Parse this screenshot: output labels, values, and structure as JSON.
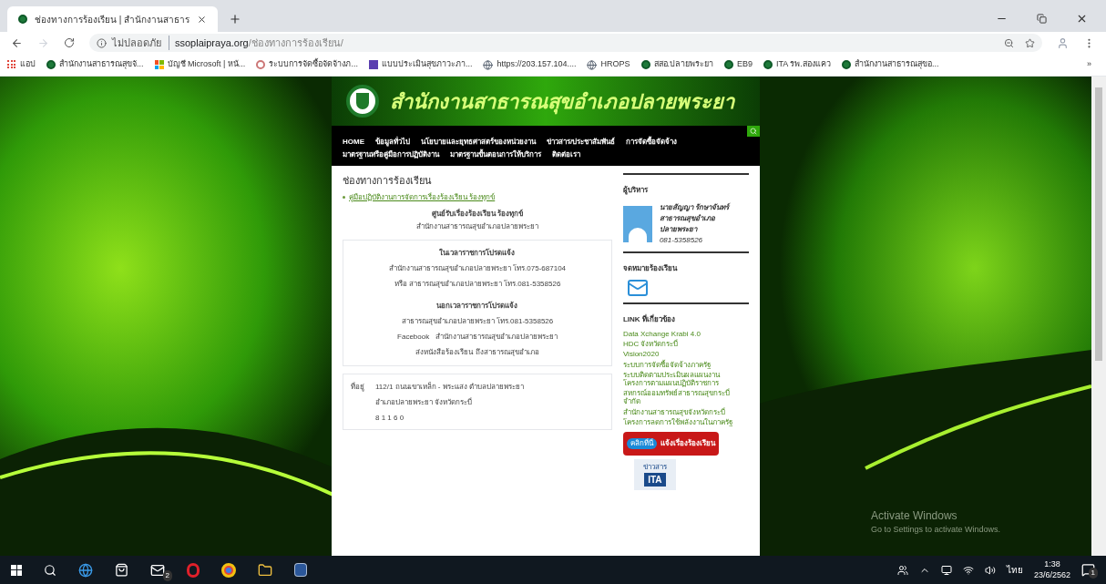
{
  "browser": {
    "tabs": [
      {
        "title": "ช่องทางการร้องเรียน | สำนักงานสาธาร",
        "selected": true
      }
    ],
    "address": {
      "security": "ไม่ปลอดภัย",
      "domain": "ssoplaipraya.org",
      "path": "/ช่องทางการร้องเรียน/"
    },
    "bookmarks": [
      {
        "kind": "apps",
        "label": "แอป"
      },
      {
        "kind": "site",
        "label": "สำนักงานสาธารณสุขจั..."
      },
      {
        "kind": "ms",
        "label": "บัญชี Microsoft | หน้..."
      },
      {
        "kind": "egp",
        "label": "ระบบการจัดซื้อจัดจ้างภ..."
      },
      {
        "kind": "form",
        "label": "แบบประเมินสุขภาวะภา..."
      },
      {
        "kind": "globe",
        "label": "https://203.157.104...."
      },
      {
        "kind": "globe",
        "label": "HROPS"
      },
      {
        "kind": "site",
        "label": "สสอ.ปลายพระยา"
      },
      {
        "kind": "site",
        "label": "EB9"
      },
      {
        "kind": "site",
        "label": "ITA รพ.สองแคว"
      },
      {
        "kind": "site",
        "label": "สำนักงานสาธารณสุขอ..."
      }
    ],
    "overflow": "»"
  },
  "site": {
    "banner_title": "สำนักงานสาธารณสุขอำเภอปลายพระยา",
    "nav": [
      "HOME",
      "ข้อมูลทั่วไป",
      "นโยบายและยุทธศาสตร์ของหน่วยงาน",
      "ข่าวสาร/ประชาสัมพันธ์",
      "การจัดซื้อจัดจ้าง",
      "มาตรฐานหรือคู่มือการปฏิบัติงาน",
      "มาตรฐานขั้นตอนการให้บริการ",
      "ติดต่อเรา"
    ],
    "page_title": "ช่องทางการร้องเรียน",
    "manual_link": "คู่มือปฏิบัติงานการจัดการเรื่องร้องเรียน ร้องทุกข์",
    "center_lines": [
      "ศูนย์รับเรื่องร้องเรียน ร้องทุกข์",
      "สำนักงานสาธารณสุขอำเภอปลายพระยา"
    ],
    "contact_box": [
      {
        "heading": "ในเวลาราชการโปรดแจ้ง",
        "lines": [
          "สำนักงานสาธารณสุขอำเภอปลายพระยา โทร.075-687104",
          "หรือ สาธารณสุขอำเภอปลายพระยา โทร.081-5358526"
        ]
      },
      {
        "heading": "นอกเวลาราชการโปรดแจ้ง",
        "lines": [
          "สาธารณสุขอำเภอปลายพระยา โทร.081-5358526",
          "Facebook   สำนักงานสาธารณสุขอำเภอปลายพระยา",
          "ส่งหนังสือร้องเรียน ถึงสาธารณสุขอำเภอ"
        ]
      }
    ],
    "address_label": "ที่อยู่",
    "address_lines": [
      "112/1 ถนนเขาเหล็ก - พระแสง ตำบลปลายพระยา",
      "อำเภอปลายพระยา จังหวัดกระบี่",
      "8 1 1 6 0"
    ],
    "sidebar": {
      "executive_heading": "ผู้บริหาร",
      "executive_name": "นายสัญญา รักษาจันทร์",
      "executive_role": [
        "สาธารณสุขอำเภอ",
        "ปลายพระยา"
      ],
      "executive_phone": "081-5358526",
      "mail_heading": "จดหมายร้องเรียน",
      "links_heading": "LINK ที่เกี่ยวข้อง",
      "links": [
        "Data Xchange Krabi 4.0",
        "HDC จังหวัดกระบี่",
        "Vision2020",
        "ระบบการจัดซื้อจัดจ้างภาครัฐ",
        "ระบบติดตามประเมินผลแผนงาน โครงการตามแผนปฏิบัติราชการ",
        "สหกรณ์ออมทรัพย์สาธารณสุขกระบี่ จำกัด",
        "สำนักงานสาธารณสุขจังหวัดกระบี่",
        "โครงการลดการใช้พลังงานในภาครัฐ"
      ],
      "complaint_banner": {
        "badge": "คลิกที่นี่",
        "label": "แจ้งเรื่องร้องเรียน"
      },
      "ita_banner": {
        "top": "ข่าวสาร",
        "bottom": "ITA"
      }
    }
  },
  "activation": {
    "title": "Activate Windows",
    "hint": "Go to Settings to activate Windows."
  },
  "taskbar": {
    "mail_badge": "2",
    "language": "ไทย",
    "time": "1:38",
    "date": "23/6/2562",
    "notification_badge": "1"
  }
}
